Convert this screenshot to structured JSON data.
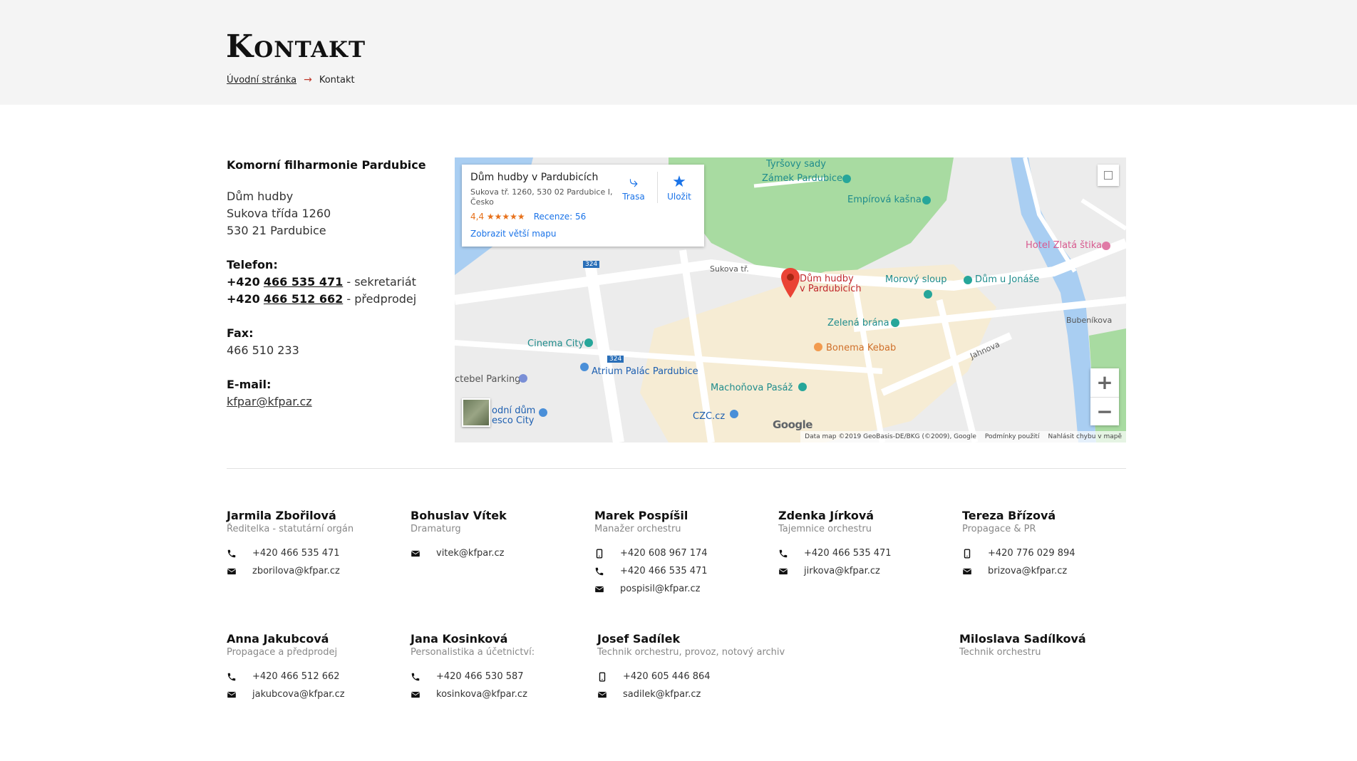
{
  "header": {
    "title": "Kontakt",
    "breadcrumb": {
      "home": "Úvodní stránka",
      "arrow": "→",
      "current": "Kontakt"
    }
  },
  "info": {
    "org": "Komorní filharmonie Pardubice",
    "address": [
      "Dům hudby",
      "Sukova třída 1260",
      "530 21 Pardubice"
    ],
    "phone_label": "Telefon:",
    "phones": [
      {
        "prefix": "+420",
        "number": "466 535 471",
        "suffix": " - sekretariát"
      },
      {
        "prefix": "+420",
        "number": "466 512 662",
        "suffix": " - předprodej"
      }
    ],
    "fax_label": "Fax:",
    "fax": "466 510 233",
    "email_label": "E-mail:",
    "email": "kfpar@kfpar.cz"
  },
  "map": {
    "card": {
      "title": "Dům hudby v Pardubicích",
      "address": "Sukova tř. 1260, 530 02 Pardubice I, Česko",
      "rating": "4,4 ★★★★★",
      "reviews": "Recenze: 56",
      "bigger_map": "Zobrazit větší mapu",
      "route": "Trasa",
      "save": "Uložit"
    },
    "pin_label": [
      "Dům hudby",
      "v Pardubicích"
    ],
    "labels": {
      "tyrsovy_sady": "Tyršovy sady",
      "zamek": "Zámek Pardubice",
      "empirova": "Empírová kašna",
      "hotel": "Hotel Zlatá štika",
      "morovy": "Morový sloup",
      "dum_u_jonase": "Dům u Jonáše",
      "zelena": "Zelená brána",
      "bonema": "Bonema Kebab",
      "cinema": "Cinema City",
      "atrium": "Atrium Palác Pardubice",
      "machonova": "Machoňova Pasáž",
      "parking": "ctebel Parking",
      "tesco1": "odní dům",
      "tesco2": "esco City",
      "czc": "CZC.cz",
      "sukova": "Sukova tř.",
      "jahnova": "Jahnova",
      "bubenikova": "Bubeníkova",
      "road324a": "324",
      "road324b": "324"
    },
    "google": "Google",
    "zoom_in": "+",
    "zoom_out": "−",
    "attribution": {
      "data": "Data map ©2019 GeoBasis-DE/BKG (©2009), Google",
      "terms": "Podmínky použití",
      "report": "Nahlásit chybu v mapě"
    }
  },
  "staff": [
    {
      "name": "Jarmila Zbořilová",
      "role": "Ředitelka - statutární orgán",
      "contacts": [
        {
          "type": "phone",
          "value": "+420 466 535 471"
        },
        {
          "type": "mail",
          "value": "zborilova@kfpar.cz"
        }
      ]
    },
    {
      "name": "Bohuslav Vítek",
      "role": "Dramaturg",
      "contacts": [
        {
          "type": "mail",
          "value": "vitek@kfpar.cz"
        }
      ]
    },
    {
      "name": "Marek Pospíšil",
      "role": "Manažer orchestru",
      "contacts": [
        {
          "type": "mobile",
          "value": "+420 608 967 174"
        },
        {
          "type": "phone",
          "value": "+420 466 535 471"
        },
        {
          "type": "mail",
          "value": "pospisil@kfpar.cz"
        }
      ]
    },
    {
      "name": "Zdenka Jírková",
      "role": "Tajemnice orchestru",
      "contacts": [
        {
          "type": "phone",
          "value": "+420 466 535 471"
        },
        {
          "type": "mail",
          "value": "jirkova@kfpar.cz"
        }
      ]
    },
    {
      "name": "Tereza Břízová",
      "role": "Propagace & PR",
      "contacts": [
        {
          "type": "mobile",
          "value": "+420 776 029 894"
        },
        {
          "type": "mail",
          "value": "brizova@kfpar.cz"
        }
      ]
    },
    {
      "name": "Anna Jakubcová",
      "role": "Propagace a předprodej",
      "contacts": [
        {
          "type": "phone",
          "value": "+420 466 512 662"
        },
        {
          "type": "mail",
          "value": "jakubcova@kfpar.cz"
        }
      ]
    },
    {
      "name": "Jana Kosinková",
      "role": "Personalistika a účetnictví:",
      "contacts": [
        {
          "type": "phone",
          "value": "+420 466 530 587"
        },
        {
          "type": "mail",
          "value": "kosinkova@kfpar.cz"
        }
      ]
    },
    {
      "name": "Josef Sadílek",
      "role": "Technik orchestru, provoz, notový archiv",
      "contacts": [
        {
          "type": "mobile",
          "value": "+420 605 446 864"
        },
        {
          "type": "mail",
          "value": "sadilek@kfpar.cz"
        }
      ]
    },
    {
      "name": "Miloslava Sadílková",
      "role": "Technik orchestru",
      "contacts": []
    }
  ]
}
